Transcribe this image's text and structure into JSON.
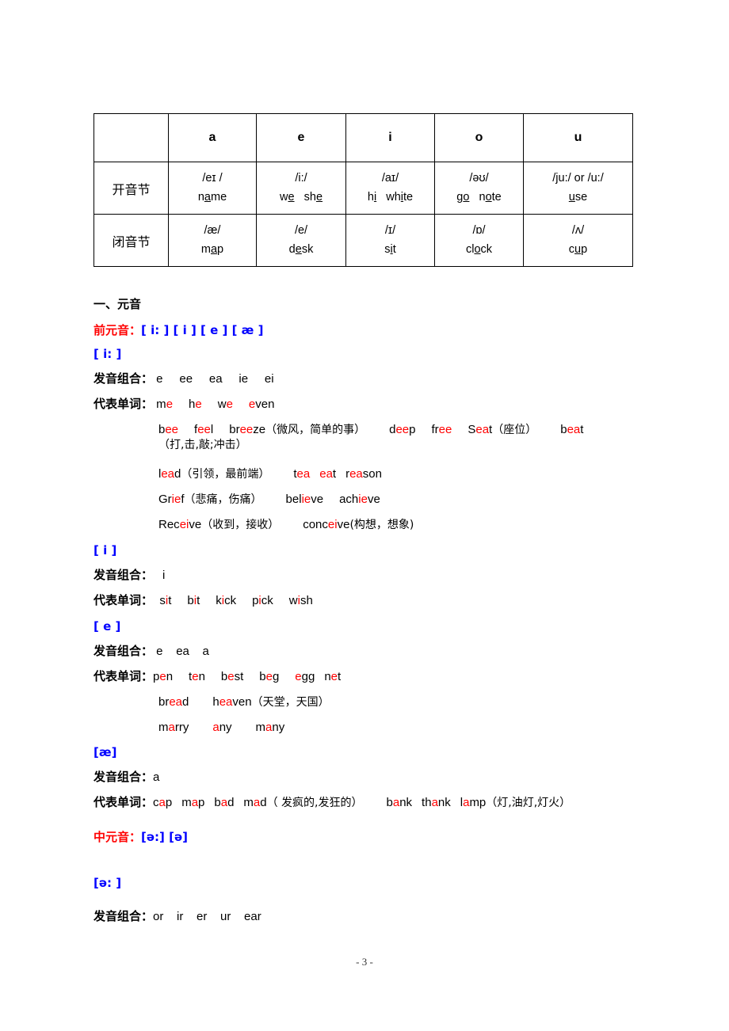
{
  "page": {
    "footer": "- 3 -",
    "colors": {
      "red": "#FF0000",
      "blue": "#0000FF",
      "black": "#000000"
    }
  },
  "syllable_table": {
    "columns": [
      "",
      "a",
      "e",
      "i",
      "o",
      "u"
    ],
    "rows": [
      {
        "label": "开音节",
        "cells": [
          {
            "ipa": "/eɪ /",
            "word_pre": "n",
            "word_mid": "a",
            "word_post": "me"
          },
          {
            "ipa": "/i:/",
            "words": "we  she"
          },
          {
            "ipa": "/aɪ/",
            "words": "hi  white"
          },
          {
            "ipa": "/əʊ/",
            "words": "go  note"
          },
          {
            "ipa": "/ju:/ or /u:/",
            "words": "use"
          }
        ]
      },
      {
        "label": "闭音节",
        "cells": [
          {
            "ipa": "/æ/",
            "words": "map"
          },
          {
            "ipa": "/e/",
            "words": "desk"
          },
          {
            "ipa": "/ɪ/",
            "words": "sit"
          },
          {
            "ipa": "/ɒ/",
            "words": "clock"
          },
          {
            "ipa": "/ʌ/",
            "words": "cup"
          }
        ]
      }
    ]
  },
  "section_one": {
    "title": "一、元音",
    "front_vowels_label": "前元音：",
    "front_vowels_symbols": "[ i: ]  [ i ]  [ e ]  [ æ ]",
    "mid_vowels_label": "中元音：",
    "mid_vowels_symbols": "[ə:]  [ə]",
    "labels": {
      "combination": "发音组合：",
      "words": "代表单词："
    },
    "groups": [
      {
        "symbol": "[ i: ]",
        "combination": "e    ee    ea    ie    ei",
        "word_lines": [
          "me  he  we  even",
          "bee  feel  breeze（微风，简单的事）  deep  free  Seat（座位）  beat（打,击,敲;冲击）",
          "lead（引领，最前端）  tea  eat  reason",
          "Grief（悲痛，伤痛）  believe  achieve",
          "Receive（收到，接收）  conceive(构想，想象)"
        ]
      },
      {
        "symbol": "[ i ]",
        "combination": "i",
        "word_lines": [
          "sit  bit  kick  pick  wish"
        ]
      },
      {
        "symbol": "[ e ]",
        "combination": "e    ea    a",
        "word_lines": [
          "pen  ten  best  beg  egg  net",
          "bread   heaven（天堂，天国）",
          "marry   any   many"
        ]
      },
      {
        "symbol": "[æ]",
        "combination": "a",
        "word_lines": [
          "cap  map  bad  mad（ 发疯的,发狂的）  bank  thank  lamp（灯,油灯,灯火）"
        ]
      },
      {
        "symbol": "[ə: ]",
        "combination": "or    ir    er    ur    ear",
        "word_lines": []
      }
    ]
  }
}
